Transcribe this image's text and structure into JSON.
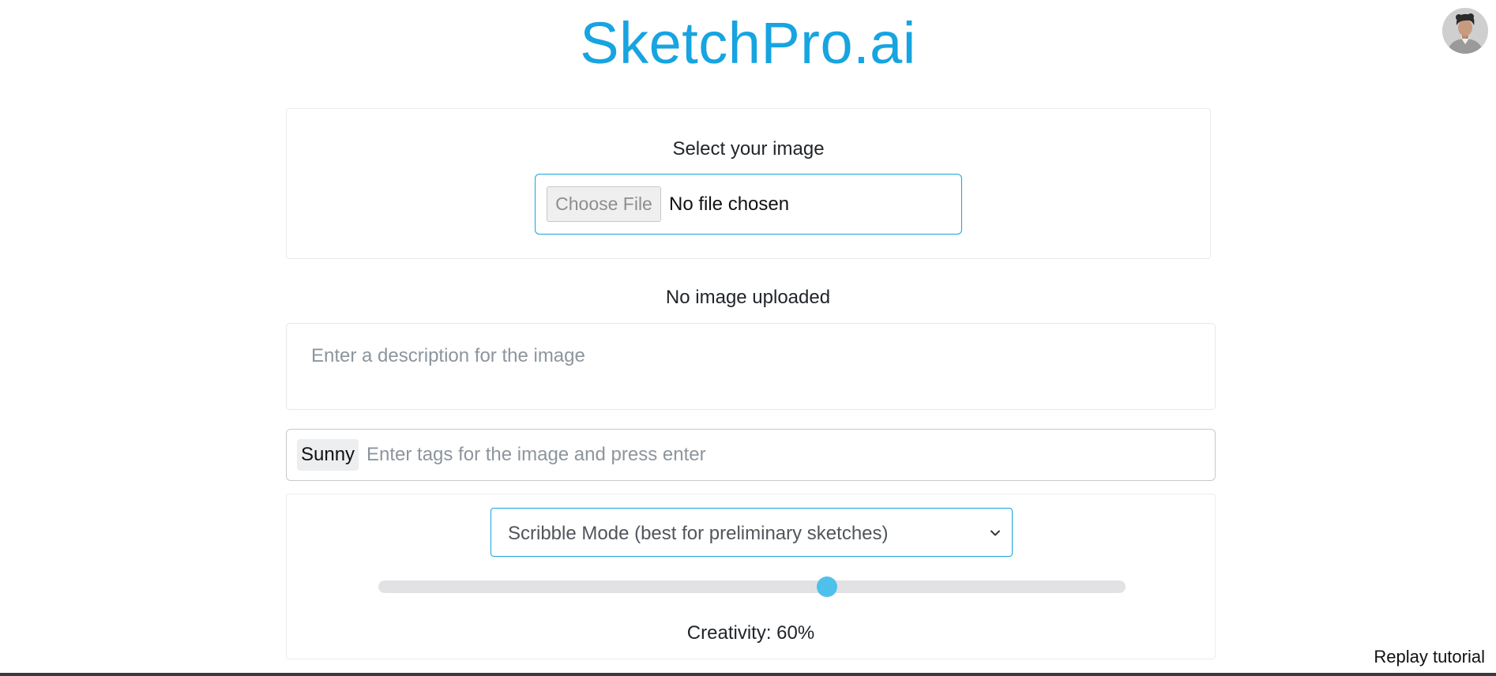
{
  "header": {
    "title": "SketchPro.ai",
    "title_color": "#17a4e0",
    "avatar_icon": "user-avatar"
  },
  "upload": {
    "label": "Select your image",
    "choose_button_label": "Choose File",
    "file_status": "No file chosen"
  },
  "preview": {
    "status": "No image uploaded"
  },
  "description": {
    "placeholder": "Enter a description for the image",
    "value": ""
  },
  "tags": {
    "items": [
      "Sunny"
    ],
    "placeholder": "Enter tags for the image and press enter"
  },
  "settings": {
    "mode_selected": "Scribble Mode (best for preliminary sketches)",
    "chevron_icon": "chevron-down",
    "creativity_value": 60,
    "creativity_label": "Creativity: 60%",
    "accent_color": "#17a4e0",
    "slider_thumb_color": "#4fc0ec"
  },
  "footer": {
    "replay_label": "Replay tutorial"
  }
}
